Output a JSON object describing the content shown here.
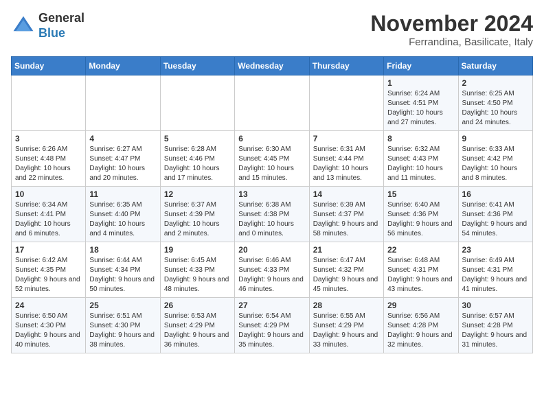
{
  "logo": {
    "general": "General",
    "blue": "Blue"
  },
  "header": {
    "month": "November 2024",
    "location": "Ferrandina, Basilicate, Italy"
  },
  "days_of_week": [
    "Sunday",
    "Monday",
    "Tuesday",
    "Wednesday",
    "Thursday",
    "Friday",
    "Saturday"
  ],
  "weeks": [
    [
      {
        "day": "",
        "info": ""
      },
      {
        "day": "",
        "info": ""
      },
      {
        "day": "",
        "info": ""
      },
      {
        "day": "",
        "info": ""
      },
      {
        "day": "",
        "info": ""
      },
      {
        "day": "1",
        "info": "Sunrise: 6:24 AM\nSunset: 4:51 PM\nDaylight: 10 hours and 27 minutes."
      },
      {
        "day": "2",
        "info": "Sunrise: 6:25 AM\nSunset: 4:50 PM\nDaylight: 10 hours and 24 minutes."
      }
    ],
    [
      {
        "day": "3",
        "info": "Sunrise: 6:26 AM\nSunset: 4:48 PM\nDaylight: 10 hours and 22 minutes."
      },
      {
        "day": "4",
        "info": "Sunrise: 6:27 AM\nSunset: 4:47 PM\nDaylight: 10 hours and 20 minutes."
      },
      {
        "day": "5",
        "info": "Sunrise: 6:28 AM\nSunset: 4:46 PM\nDaylight: 10 hours and 17 minutes."
      },
      {
        "day": "6",
        "info": "Sunrise: 6:30 AM\nSunset: 4:45 PM\nDaylight: 10 hours and 15 minutes."
      },
      {
        "day": "7",
        "info": "Sunrise: 6:31 AM\nSunset: 4:44 PM\nDaylight: 10 hours and 13 minutes."
      },
      {
        "day": "8",
        "info": "Sunrise: 6:32 AM\nSunset: 4:43 PM\nDaylight: 10 hours and 11 minutes."
      },
      {
        "day": "9",
        "info": "Sunrise: 6:33 AM\nSunset: 4:42 PM\nDaylight: 10 hours and 8 minutes."
      }
    ],
    [
      {
        "day": "10",
        "info": "Sunrise: 6:34 AM\nSunset: 4:41 PM\nDaylight: 10 hours and 6 minutes."
      },
      {
        "day": "11",
        "info": "Sunrise: 6:35 AM\nSunset: 4:40 PM\nDaylight: 10 hours and 4 minutes."
      },
      {
        "day": "12",
        "info": "Sunrise: 6:37 AM\nSunset: 4:39 PM\nDaylight: 10 hours and 2 minutes."
      },
      {
        "day": "13",
        "info": "Sunrise: 6:38 AM\nSunset: 4:38 PM\nDaylight: 10 hours and 0 minutes."
      },
      {
        "day": "14",
        "info": "Sunrise: 6:39 AM\nSunset: 4:37 PM\nDaylight: 9 hours and 58 minutes."
      },
      {
        "day": "15",
        "info": "Sunrise: 6:40 AM\nSunset: 4:36 PM\nDaylight: 9 hours and 56 minutes."
      },
      {
        "day": "16",
        "info": "Sunrise: 6:41 AM\nSunset: 4:36 PM\nDaylight: 9 hours and 54 minutes."
      }
    ],
    [
      {
        "day": "17",
        "info": "Sunrise: 6:42 AM\nSunset: 4:35 PM\nDaylight: 9 hours and 52 minutes."
      },
      {
        "day": "18",
        "info": "Sunrise: 6:44 AM\nSunset: 4:34 PM\nDaylight: 9 hours and 50 minutes."
      },
      {
        "day": "19",
        "info": "Sunrise: 6:45 AM\nSunset: 4:33 PM\nDaylight: 9 hours and 48 minutes."
      },
      {
        "day": "20",
        "info": "Sunrise: 6:46 AM\nSunset: 4:33 PM\nDaylight: 9 hours and 46 minutes."
      },
      {
        "day": "21",
        "info": "Sunrise: 6:47 AM\nSunset: 4:32 PM\nDaylight: 9 hours and 45 minutes."
      },
      {
        "day": "22",
        "info": "Sunrise: 6:48 AM\nSunset: 4:31 PM\nDaylight: 9 hours and 43 minutes."
      },
      {
        "day": "23",
        "info": "Sunrise: 6:49 AM\nSunset: 4:31 PM\nDaylight: 9 hours and 41 minutes."
      }
    ],
    [
      {
        "day": "24",
        "info": "Sunrise: 6:50 AM\nSunset: 4:30 PM\nDaylight: 9 hours and 40 minutes."
      },
      {
        "day": "25",
        "info": "Sunrise: 6:51 AM\nSunset: 4:30 PM\nDaylight: 9 hours and 38 minutes."
      },
      {
        "day": "26",
        "info": "Sunrise: 6:53 AM\nSunset: 4:29 PM\nDaylight: 9 hours and 36 minutes."
      },
      {
        "day": "27",
        "info": "Sunrise: 6:54 AM\nSunset: 4:29 PM\nDaylight: 9 hours and 35 minutes."
      },
      {
        "day": "28",
        "info": "Sunrise: 6:55 AM\nSunset: 4:29 PM\nDaylight: 9 hours and 33 minutes."
      },
      {
        "day": "29",
        "info": "Sunrise: 6:56 AM\nSunset: 4:28 PM\nDaylight: 9 hours and 32 minutes."
      },
      {
        "day": "30",
        "info": "Sunrise: 6:57 AM\nSunset: 4:28 PM\nDaylight: 9 hours and 31 minutes."
      }
    ]
  ]
}
